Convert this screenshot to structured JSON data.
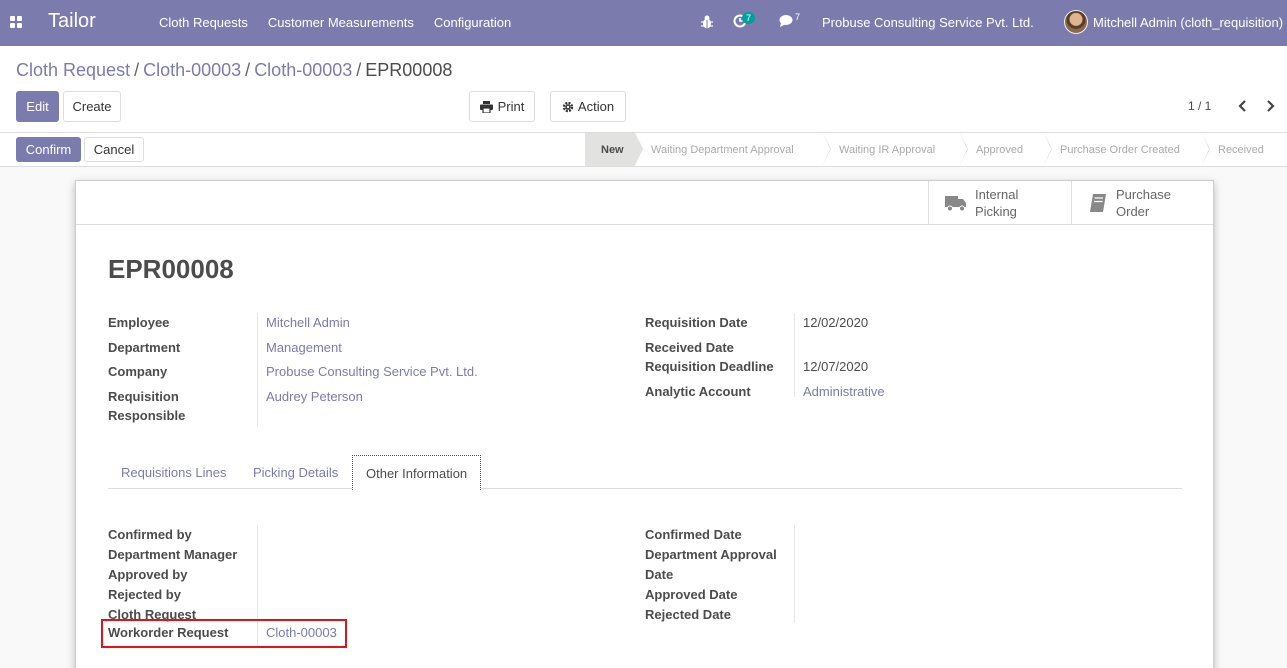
{
  "navbar": {
    "brand": "Tailor",
    "menu": [
      "Cloth Requests",
      "Customer Measurements",
      "Configuration"
    ],
    "activity_count": "7",
    "message_count": "7",
    "company": "Probuse Consulting Service Pvt. Ltd.",
    "user": "Mitchell Admin (cloth_requisition)"
  },
  "breadcrumb": {
    "items": [
      "Cloth Request",
      "Cloth-00003",
      "Cloth-00003"
    ],
    "separator": "/",
    "current": "EPR00008"
  },
  "toolbar": {
    "edit": "Edit",
    "create": "Create",
    "print": "Print",
    "action": "Action"
  },
  "pager": {
    "value": "1 / 1"
  },
  "statusbar": {
    "confirm": "Confirm",
    "cancel": "Cancel",
    "steps": [
      "New",
      "Waiting Department Approval",
      "Waiting IR Approval",
      "Approved",
      "Purchase Order Created",
      "Received"
    ],
    "active_step": "New"
  },
  "smart_buttons": {
    "internal_picking": [
      "Internal",
      "Picking"
    ],
    "purchase_order": [
      "Purchase",
      "Order"
    ]
  },
  "record": {
    "name": "EPR00008",
    "left": {
      "employee_label": "Employee",
      "employee": "Mitchell Admin",
      "department_label": "Department",
      "department": "Management",
      "company_label": "Company",
      "company": "Probuse Consulting Service Pvt. Ltd.",
      "responsible_label_1": "Requisition",
      "responsible_label_2": "Responsible",
      "responsible": "Audrey Peterson"
    },
    "right": {
      "req_date_label": "Requisition Date",
      "req_date": "12/02/2020",
      "received_date_label": "Received Date",
      "deadline_label": "Requisition Deadline",
      "deadline": "12/07/2020",
      "analytic_label": "Analytic Account",
      "analytic": "Administrative"
    }
  },
  "tabs": [
    "Requisitions Lines",
    "Picking Details",
    "Other Information"
  ],
  "other_info": {
    "left_labels": [
      "Confirmed by",
      "Department Manager",
      "Approved by",
      "Rejected by",
      "Cloth Request"
    ],
    "workorder_label": "Workorder Request",
    "workorder_value": "Cloth-00003",
    "right_labels": [
      "Confirmed Date",
      "Department Approval",
      "Date",
      "Approved Date",
      "Rejected Date"
    ]
  },
  "colors": {
    "brand": "#7c7bad",
    "highlight": "#e0131b",
    "badge": "#00a09d"
  }
}
